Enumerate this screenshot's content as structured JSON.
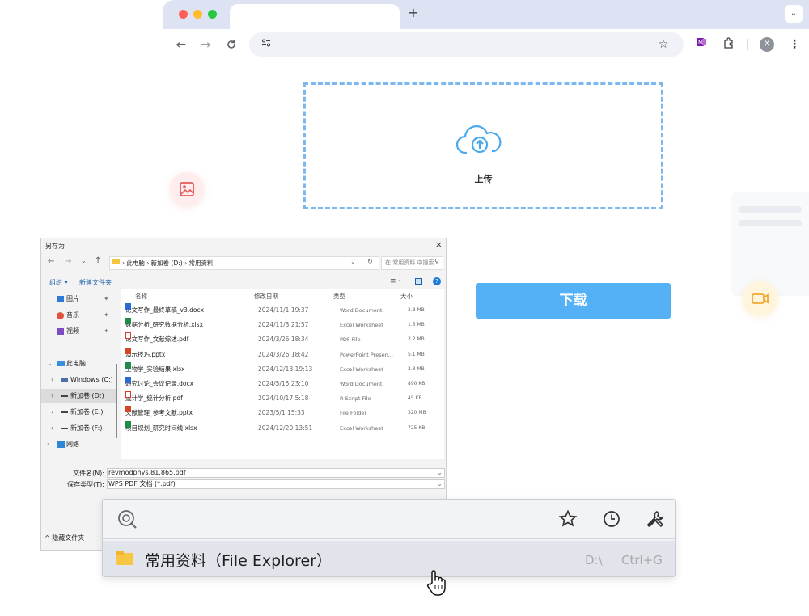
{
  "colors": {
    "accent": "#55b1f5",
    "dash": "#7ab8ef",
    "tab_bar": "#dde3f3"
  },
  "browser": {
    "new_tab": "+",
    "tab_menu": "⌄",
    "back": "←",
    "forward": "→",
    "reload": "C",
    "site_info": "⚙",
    "profile": "X"
  },
  "upload": {
    "label": "上传",
    "icon": "cloud-upload-icon"
  },
  "download": {
    "label": "下载"
  },
  "dialog": {
    "title": "另存为",
    "close": "×",
    "breadcrumb": [
      "此电脑",
      "新加卷 (D:)",
      "常用资料"
    ],
    "search_placeholder": "在 常用资料 中搜索",
    "organize": "组织 ▾",
    "new_folder": "新建文件夹",
    "sidebar": [
      {
        "label": "图片",
        "pin": true
      },
      {
        "label": "音乐",
        "pin": true
      },
      {
        "label": "视频",
        "pin": true
      },
      {
        "label": "此电脑",
        "pin": false
      },
      {
        "label": "Windows (C:)",
        "pin": false
      },
      {
        "label": "新加卷 (D:)",
        "pin": false
      },
      {
        "label": "新加卷 (E:)",
        "pin": false
      },
      {
        "label": "新加卷 (F:)",
        "pin": false
      },
      {
        "label": "网络",
        "pin": false
      }
    ],
    "columns": {
      "name": "名称",
      "date": "修改日期",
      "type": "类型",
      "size": "大小"
    },
    "files": [
      {
        "name": "论文写作_最终草稿_v3.docx",
        "date": "2024/11/1 19:37",
        "type": "Word Document",
        "size": "2.8 MB",
        "kind": "word"
      },
      {
        "name": "数据分析_研究数据分析.xlsx",
        "date": "2024/11/3 21:57",
        "type": "Excel Worksheet",
        "size": "1.5 MB",
        "kind": "excel"
      },
      {
        "name": "论文写作_文献综述.pdf",
        "date": "2024/3/26 18:34",
        "type": "PDF File",
        "size": "3.2 MB",
        "kind": "pdf"
      },
      {
        "name": "演示技巧.pptx",
        "date": "2024/3/26 18:42",
        "type": "PowerPoint Presen...",
        "size": "5.1 MB",
        "kind": "ppt"
      },
      {
        "name": "生物学_实验结果.xlsx",
        "date": "2024/12/13 19:13",
        "type": "Excel Worksheet",
        "size": "2.3 MB",
        "kind": "excel"
      },
      {
        "name": "研究讨论_会议记录.docx",
        "date": "2024/5/15 23:10",
        "type": "Word Document",
        "size": "890 KB",
        "kind": "word"
      },
      {
        "name": "统计学_统计分析.pdf",
        "date": "2024/10/17 5:18",
        "type": "R Script File",
        "size": "45 KB",
        "kind": "pdf"
      },
      {
        "name": "文献管理_参考文献.pptx",
        "date": "2023/5/1 15:33",
        "type": "File Folder",
        "size": "320 MB",
        "kind": "ppt"
      },
      {
        "name": "项目规划_研究时间线.xlsx",
        "date": "2024/12/20 13:51",
        "type": "Excel Worksheet",
        "size": "725 KB",
        "kind": "excel"
      }
    ],
    "filename_label": "文件名(N):",
    "filename_value": "revmodphys.81.865.pdf",
    "filetype_label": "保存类型(T):",
    "filetype_value": "WPS PDF 文档 (*.pdf)",
    "hide_folders": "隐藏文件夹"
  },
  "popup": {
    "result_label": "常用资料（File Explorer）",
    "result_path": "D:\\",
    "result_shortcut": "Ctrl+G"
  }
}
